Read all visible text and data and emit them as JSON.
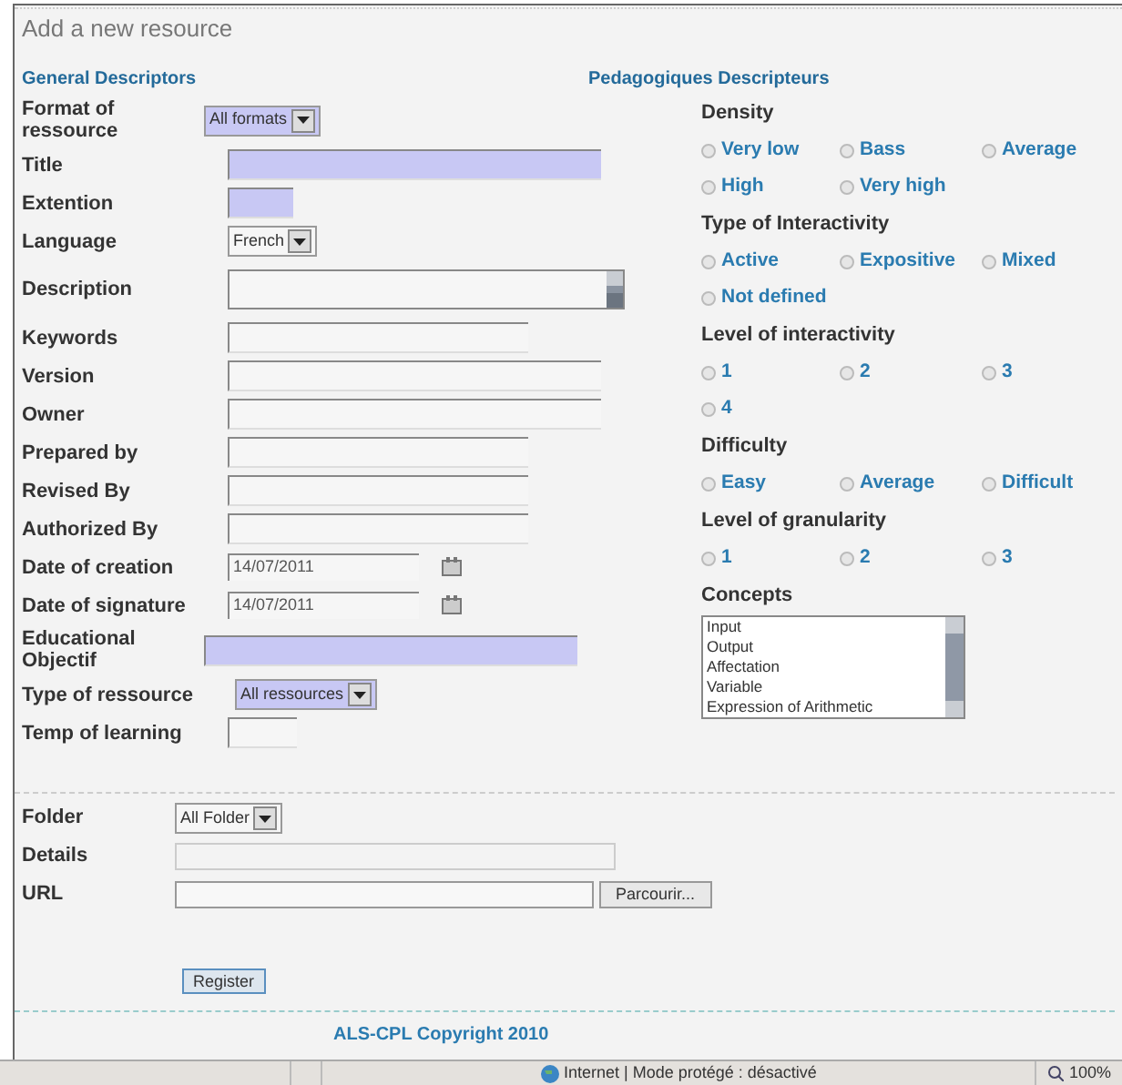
{
  "page": {
    "title": "Add a new resource"
  },
  "general": {
    "heading": "General Descriptors",
    "fields": [
      {
        "label": "Format of ressource",
        "kind": "select",
        "value": "All formats",
        "highlighted": true
      },
      {
        "label": "Title",
        "kind": "text",
        "highlighted": true
      },
      {
        "label": "Extention",
        "kind": "text",
        "highlighted": true
      },
      {
        "label": "Language",
        "kind": "select",
        "value": "French",
        "highlighted": false
      },
      {
        "label": "Description",
        "kind": "textarea",
        "highlighted": false
      },
      {
        "label": "Keywords",
        "kind": "text",
        "highlighted": false
      },
      {
        "label": "Version",
        "kind": "text",
        "highlighted": false
      },
      {
        "label": "Owner",
        "kind": "text",
        "highlighted": false
      },
      {
        "label": "Prepared by",
        "kind": "text",
        "highlighted": false
      },
      {
        "label": "Revised By",
        "kind": "text",
        "highlighted": false
      },
      {
        "label": "Authorized By",
        "kind": "text",
        "highlighted": false
      },
      {
        "label": "Date of creation",
        "kind": "date",
        "value": "14/07/2011",
        "highlighted": false
      },
      {
        "label": "Date of signature",
        "kind": "date",
        "value": "14/07/2011",
        "highlighted": false
      },
      {
        "label": "Educational Objectif",
        "kind": "text",
        "highlighted": true
      },
      {
        "label": "Type of ressource",
        "kind": "select",
        "value": "All ressources",
        "highlighted": true
      },
      {
        "label": "Temp of learning",
        "kind": "text",
        "highlighted": false
      }
    ]
  },
  "pedagogic": {
    "heading": "Pedagogiques Descripteurs",
    "groups": [
      {
        "label": "Density",
        "options": [
          {
            "label": "Very low",
            "selected": false
          },
          {
            "label": "Bass",
            "selected": false
          },
          {
            "label": "Average",
            "selected": false
          },
          {
            "label": "High",
            "selected": false
          },
          {
            "label": "Very high",
            "selected": false
          }
        ]
      },
      {
        "label": "Type of Interactivity",
        "options": [
          {
            "label": "Active",
            "selected": false
          },
          {
            "label": "Expositive",
            "selected": false
          },
          {
            "label": "Mixed",
            "selected": false
          },
          {
            "label": "Not defined",
            "selected": false
          }
        ]
      },
      {
        "label": "Level of interactivity",
        "options": [
          {
            "label": "1",
            "selected": false
          },
          {
            "label": "2",
            "selected": false
          },
          {
            "label": "3",
            "selected": false
          },
          {
            "label": "4",
            "selected": false
          }
        ]
      },
      {
        "label": "Difficulty",
        "options": [
          {
            "label": "Easy",
            "selected": false
          },
          {
            "label": "Average",
            "selected": false
          },
          {
            "label": "Difficult",
            "selected": false
          }
        ]
      },
      {
        "label": "Level of granularity",
        "options": [
          {
            "label": "1",
            "selected": false
          },
          {
            "label": "2",
            "selected": false
          },
          {
            "label": "3",
            "selected": false
          }
        ]
      }
    ],
    "concepts": {
      "label": "Concepts",
      "items": [
        "Input",
        "Output",
        "Affectation",
        "Variable",
        "Expression of Arithmetic"
      ]
    }
  },
  "storage": {
    "fields": [
      {
        "label": "Folder",
        "kind": "select",
        "value": "All Folder"
      },
      {
        "label": "Details",
        "kind": "text"
      },
      {
        "label": "URL",
        "kind": "file",
        "button": "Parcourir..."
      }
    ]
  },
  "register_button": "Register",
  "footer": "ALS-CPL Copyright 2010",
  "status_bar": {
    "zone": "Internet | Mode protégé : désactivé",
    "zoom": "100%"
  }
}
